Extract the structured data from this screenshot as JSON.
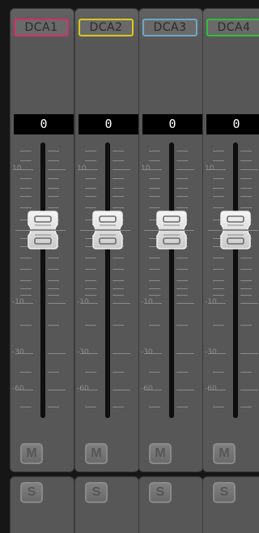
{
  "scale_labels": [
    "10",
    "-10",
    "-30",
    "-60"
  ],
  "channels": [
    {
      "name": "DCA1",
      "color": "#d0306a",
      "level": "0",
      "mute_label": "M",
      "solo_label": "S"
    },
    {
      "name": "DCA2",
      "color": "#d8c81e",
      "level": "0",
      "mute_label": "M",
      "solo_label": "S"
    },
    {
      "name": "DCA3",
      "color": "#6fa8c4",
      "level": "0",
      "mute_label": "M",
      "solo_label": "S"
    },
    {
      "name": "DCA4",
      "color": "#2fc03a",
      "level": "0",
      "mute_label": "M",
      "solo_label": "S"
    }
  ]
}
